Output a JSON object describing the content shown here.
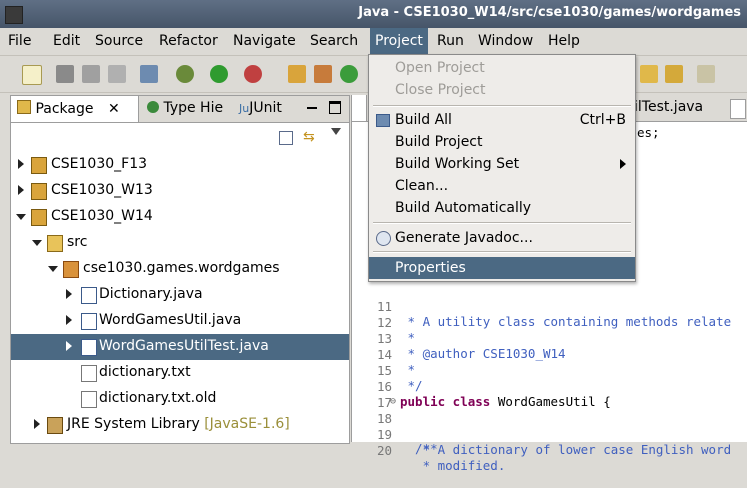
{
  "window": {
    "title": "Java - CSE1030_W14/src/cse1030/games/wordgames"
  },
  "menubar": [
    {
      "label": "File"
    },
    {
      "label": "Edit"
    },
    {
      "label": "Source"
    },
    {
      "label": "Refactor"
    },
    {
      "label": "Navigate"
    },
    {
      "label": "Search"
    },
    {
      "label": "Project"
    },
    {
      "label": "Run"
    },
    {
      "label": "Window"
    },
    {
      "label": "Help"
    }
  ],
  "left_tabs": [
    {
      "label": "Package",
      "icon": "package-explorer-icon"
    },
    {
      "label": "Type Hie",
      "icon": "type-hierarchy-icon"
    },
    {
      "label": "JUnit",
      "icon": "junit-icon"
    }
  ],
  "tree": [
    {
      "label": "CSE1030_F13",
      "icon": "project-icon",
      "expanded": false
    },
    {
      "label": "CSE1030_W13",
      "icon": "project-icon",
      "expanded": false
    },
    {
      "label": "CSE1030_W14",
      "icon": "project-icon",
      "expanded": true
    },
    {
      "label": "src",
      "icon": "source-folder-icon",
      "expanded": true
    },
    {
      "label": "cse1030.games.wordgames",
      "icon": "package-icon",
      "expanded": true
    },
    {
      "label": "Dictionary.java",
      "icon": "java-file-icon",
      "expanded": false
    },
    {
      "label": "WordGamesUtil.java",
      "icon": "java-file-icon",
      "expanded": false
    },
    {
      "label": "WordGamesUtilTest.java",
      "icon": "java-file-icon",
      "expanded": false,
      "selected": true
    },
    {
      "label": "dictionary.txt",
      "icon": "text-file-icon"
    },
    {
      "label": "dictionary.txt.old",
      "icon": "text-file-icon"
    },
    {
      "label": "JRE System Library",
      "suffix": "[JavaSE-1.6]",
      "icon": "library-icon",
      "expanded": false
    }
  ],
  "editor": {
    "tab_partial": "ilTest.java",
    "partial_line": "es;",
    "lines": [
      {
        "n": "11",
        "text": " * A utility class containing methods relate",
        "kind": "comment"
      },
      {
        "n": "12",
        "text": " *",
        "kind": "comment"
      },
      {
        "n": "13",
        "text": " * @author CSE1030_W14",
        "kind": "comment"
      },
      {
        "n": "14",
        "text": " *",
        "kind": "comment"
      },
      {
        "n": "15",
        "text": " */",
        "kind": "comment"
      },
      {
        "n": "16",
        "text": "public class WordGamesUtil {",
        "kind": "code"
      },
      {
        "n": "17",
        "text": "",
        "kind": "code"
      },
      {
        "n": "18",
        "text": "  /**",
        "kind": "comment",
        "fold": true
      },
      {
        "n": "19",
        "text": "   * A dictionary of lower case English word",
        "kind": "comment"
      },
      {
        "n": "20",
        "text": "   * modified.",
        "kind": "comment"
      }
    ]
  },
  "project_menu": [
    {
      "label": "Open Project",
      "enabled": false
    },
    {
      "label": "Close Project",
      "enabled": false
    },
    {
      "separator": true
    },
    {
      "label": "Build All",
      "accel": "Ctrl+B",
      "enabled": true,
      "icon": "build-all-icon"
    },
    {
      "label": "Build Project",
      "enabled": true
    },
    {
      "label": "Build Working Set",
      "enabled": true,
      "submenu": true
    },
    {
      "label": "Clean...",
      "enabled": true
    },
    {
      "label": "Build Automatically",
      "enabled": true
    },
    {
      "separator": true
    },
    {
      "label": "Generate Javadoc...",
      "enabled": true,
      "icon": "javadoc-icon"
    },
    {
      "separator": true
    },
    {
      "label": "Properties",
      "enabled": true,
      "highlighted": true
    }
  ]
}
